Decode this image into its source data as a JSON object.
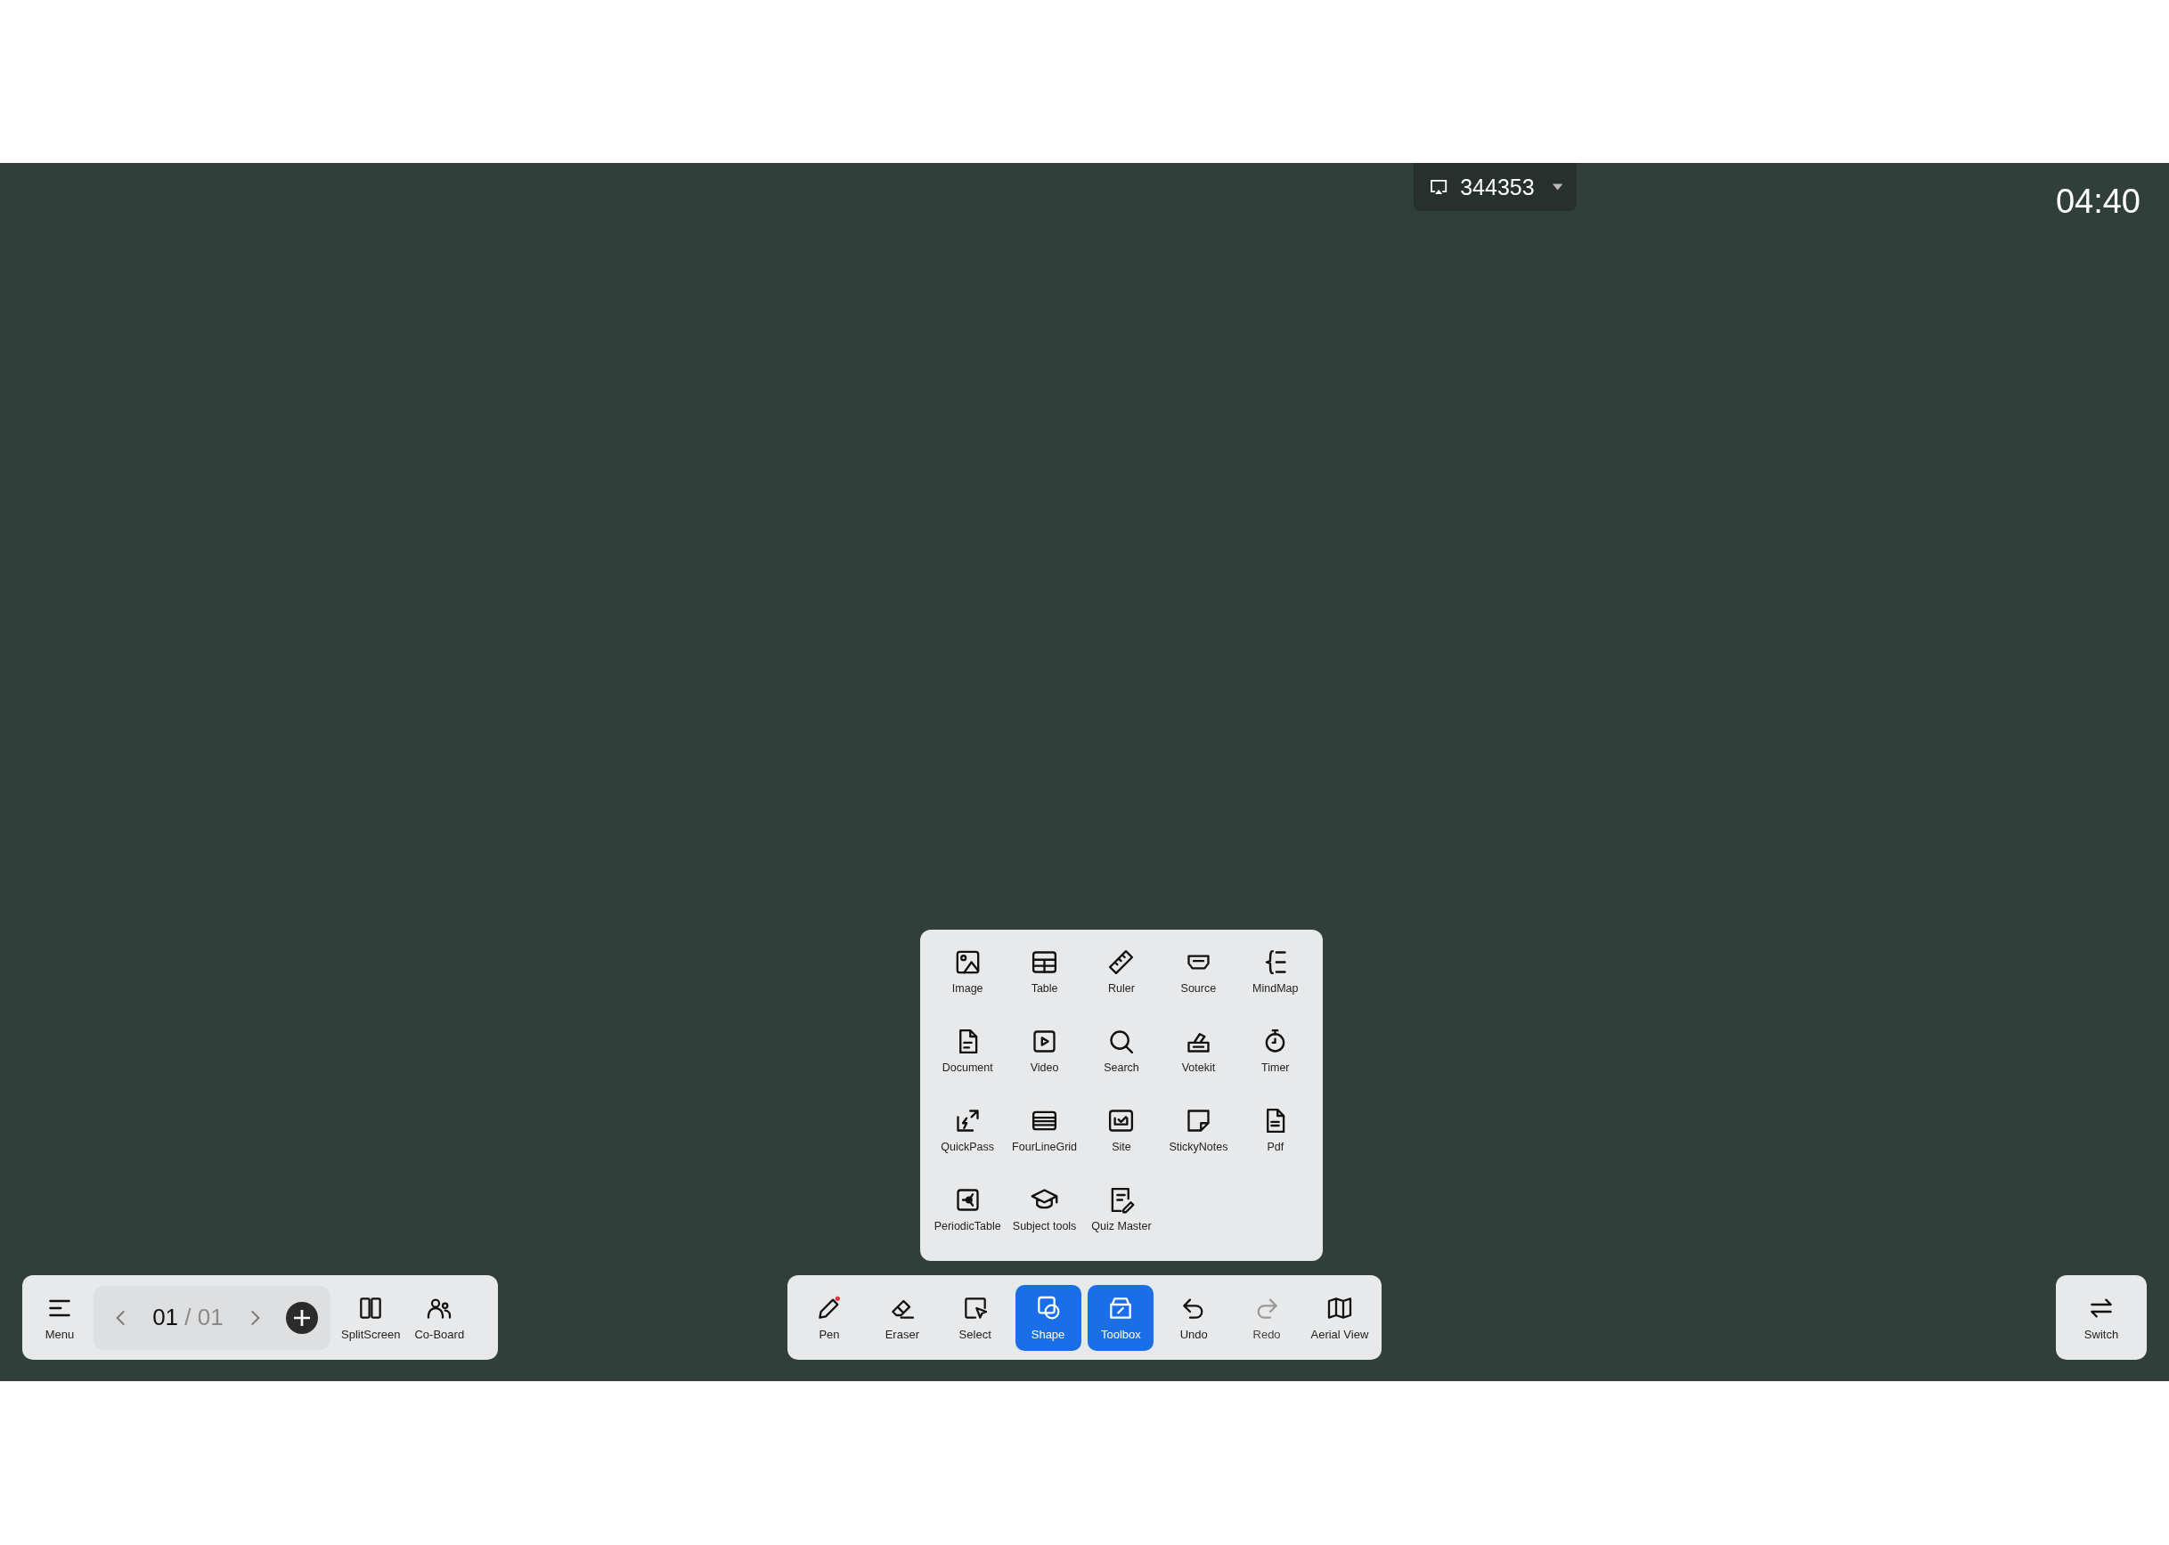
{
  "top_bar": {
    "cast_code": "344353",
    "clock": "04:40"
  },
  "toolbox": {
    "items": [
      {
        "label": "Image"
      },
      {
        "label": "Table"
      },
      {
        "label": "Ruler"
      },
      {
        "label": "Source"
      },
      {
        "label": "MindMap"
      },
      {
        "label": "Document"
      },
      {
        "label": "Video"
      },
      {
        "label": "Search"
      },
      {
        "label": "Votekit"
      },
      {
        "label": "Timer"
      },
      {
        "label": "QuickPass"
      },
      {
        "label": "FourLineGrid"
      },
      {
        "label": "Site"
      },
      {
        "label": "StickyNotes"
      },
      {
        "label": "Pdf"
      },
      {
        "label": "PeriodicTable"
      },
      {
        "label": "Subject tools"
      },
      {
        "label": "Quiz Master"
      }
    ]
  },
  "left_toolbar": {
    "menu": "Menu",
    "page": {
      "current": "01",
      "separator": "/",
      "total": "01"
    },
    "buttons": [
      {
        "label": "SplitScreen"
      },
      {
        "label": "Co-Board"
      }
    ]
  },
  "main_toolbar": [
    {
      "label": "Pen",
      "selected": false,
      "disabled": false
    },
    {
      "label": "Eraser",
      "selected": false,
      "disabled": false
    },
    {
      "label": "Select",
      "selected": false,
      "disabled": false
    },
    {
      "label": "Shape",
      "selected": true,
      "disabled": false
    },
    {
      "label": "Toolbox",
      "selected": true,
      "disabled": false
    },
    {
      "label": "Undo",
      "selected": false,
      "disabled": false
    },
    {
      "label": "Redo",
      "selected": false,
      "disabled": true
    },
    {
      "label": "Aerial View",
      "selected": false,
      "disabled": false
    }
  ],
  "switch": {
    "label": "Switch"
  }
}
